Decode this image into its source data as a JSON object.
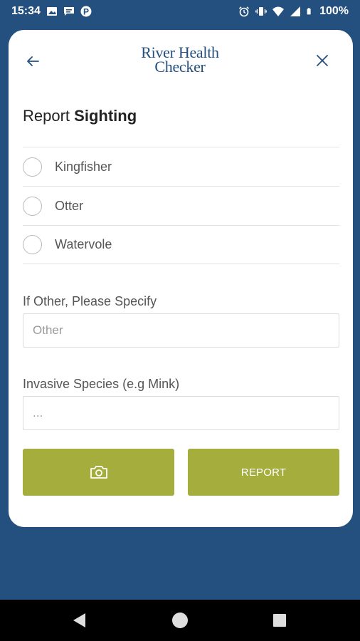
{
  "status_bar": {
    "time": "15:34",
    "battery_percent": "100%",
    "left_icons": [
      "photo-icon",
      "message-icon",
      "parking-icon"
    ],
    "right_icons": [
      "alarm-icon",
      "vibrate-icon",
      "wifi-icon",
      "signal-icon",
      "battery-icon"
    ]
  },
  "header": {
    "logo_line1": "River Health",
    "logo_line2": "Checker",
    "back_icon": "arrow-left-icon",
    "close_icon": "close-icon"
  },
  "title": {
    "prefix": "Report",
    "emphasis": "Sighting"
  },
  "species": {
    "options": [
      {
        "label": "Kingfisher",
        "selected": false
      },
      {
        "label": "Otter",
        "selected": false
      },
      {
        "label": "Watervole",
        "selected": false
      }
    ]
  },
  "other_field": {
    "label": "If Other, Please Specify",
    "placeholder": "Other",
    "value": ""
  },
  "invasive_field": {
    "label": "Invasive Species (e.g Mink)",
    "placeholder": "...",
    "value": ""
  },
  "actions": {
    "camera_icon": "camera-icon",
    "report_label": "REPORT"
  },
  "colors": {
    "background": "#23507f",
    "button": "#a5ae3d",
    "logo": "#23507f"
  }
}
